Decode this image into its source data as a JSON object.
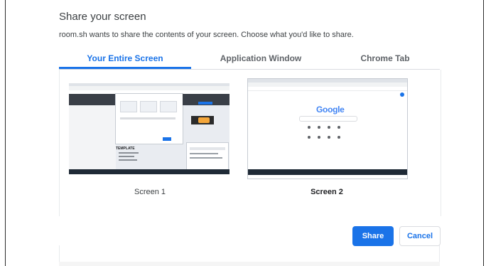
{
  "dialog": {
    "title": "Share your screen",
    "description": "room.sh wants to share the contents of your screen. Choose what you'd like to share."
  },
  "tabs": [
    {
      "label": "Your Entire Screen",
      "active": true
    },
    {
      "label": "Application Window",
      "active": false
    },
    {
      "label": "Chrome Tab",
      "active": false
    }
  ],
  "screens": [
    {
      "label": "Screen 1",
      "selected": false,
      "preview_text": "TEMPLATE"
    },
    {
      "label": "Screen 2",
      "selected": true,
      "preview_text": "Google"
    }
  ],
  "buttons": {
    "share": "Share",
    "cancel": "Cancel"
  },
  "colors": {
    "accent": "#1a73e8",
    "text": "#202124",
    "muted": "#5f6368"
  }
}
